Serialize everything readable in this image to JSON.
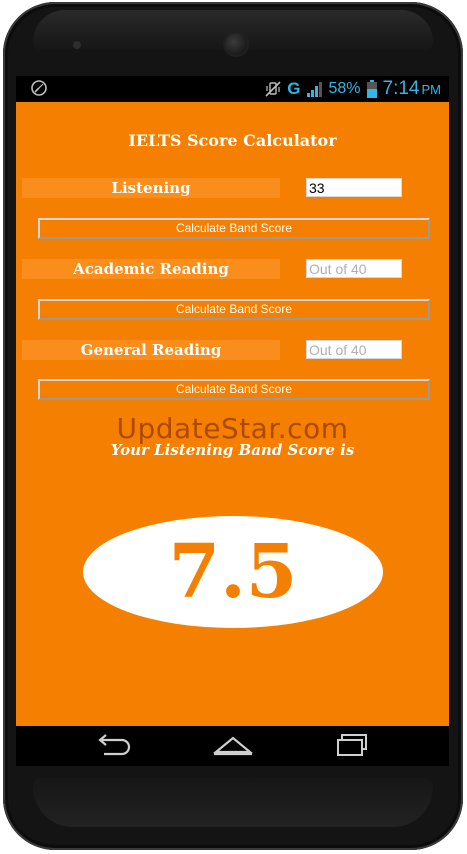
{
  "status_bar": {
    "network_type": "G",
    "battery_percent": "58%",
    "time": "7:14",
    "ampm": "PM"
  },
  "app": {
    "title": "IELTS Score Calculator",
    "sections": [
      {
        "label": "Listening",
        "input_value": "33",
        "input_placeholder": "",
        "button_label": "Calculate Band Score"
      },
      {
        "label": "Academic Reading",
        "input_value": "",
        "input_placeholder": "Out of 40",
        "button_label": "Calculate Band Score"
      },
      {
        "label": "General Reading",
        "input_value": "",
        "input_placeholder": "Out of 40",
        "button_label": "Calculate Band Score"
      }
    ],
    "result_text": "Your Listening Band Score is",
    "score": "7.5",
    "watermark": "UpdateStar.com"
  },
  "colors": {
    "background": "#f57f00",
    "label_bar": "#f98e1d",
    "status_accent": "#33b5e5",
    "score_text": "#f57f00"
  },
  "icons": {
    "status_left": "gauge-icon",
    "status_mute": "vibrate-mute-icon",
    "signal": "signal-bars-icon",
    "battery": "battery-icon",
    "nav_back": "back-icon",
    "nav_home": "home-icon",
    "nav_recents": "recents-icon"
  }
}
